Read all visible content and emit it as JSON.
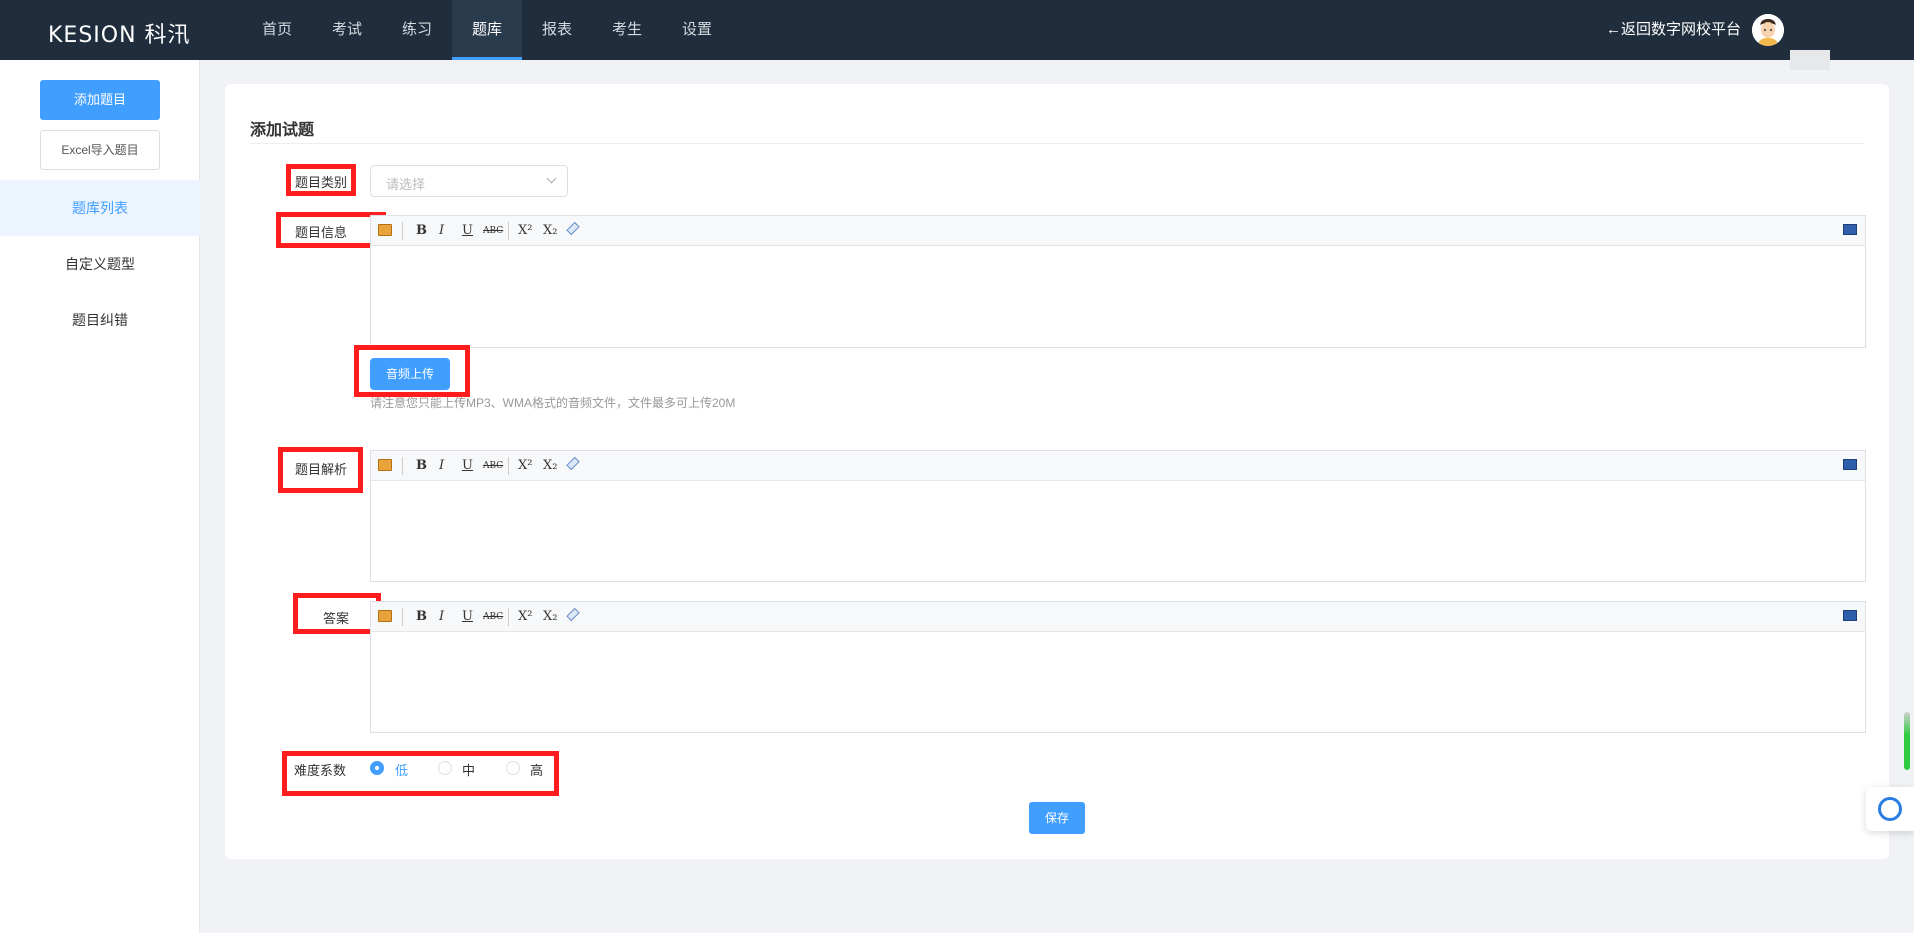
{
  "header": {
    "logo": "KESION 科汛",
    "nav": [
      "首页",
      "考试",
      "练习",
      "题库",
      "报表",
      "考生",
      "设置"
    ],
    "active_nav": "题库",
    "back_link": "←返回数字网校平台"
  },
  "sidebar": {
    "add_button": "添加题目",
    "import_button": "Excel导入题目",
    "items": [
      {
        "label": "题库列表",
        "active": true
      },
      {
        "label": "自定义题型",
        "active": false
      },
      {
        "label": "题目纠错",
        "active": false
      }
    ]
  },
  "form": {
    "title": "添加试题",
    "category_label": "题目类别",
    "category_placeholder": "请选择",
    "info_label": "题目信息",
    "upload_button": "音频上传",
    "upload_hint": "请注意您只能上传MP3、WMA格式的音频文件，文件最多可上传20M",
    "analysis_label": "题目解析",
    "answer_label": "答案",
    "difficulty_label": "难度系数",
    "difficulty_options": [
      "低",
      "中",
      "高"
    ],
    "difficulty_selected": "低",
    "save_button": "保存"
  },
  "toolbar": {
    "bold": "B",
    "italic": "I",
    "underline": "U",
    "strike": "ABC",
    "superscript": "X²",
    "subscript": "X₂"
  },
  "colors": {
    "accent": "#409eff",
    "header_bg": "#1f2d3d",
    "highlight": "#ff1c1c"
  }
}
